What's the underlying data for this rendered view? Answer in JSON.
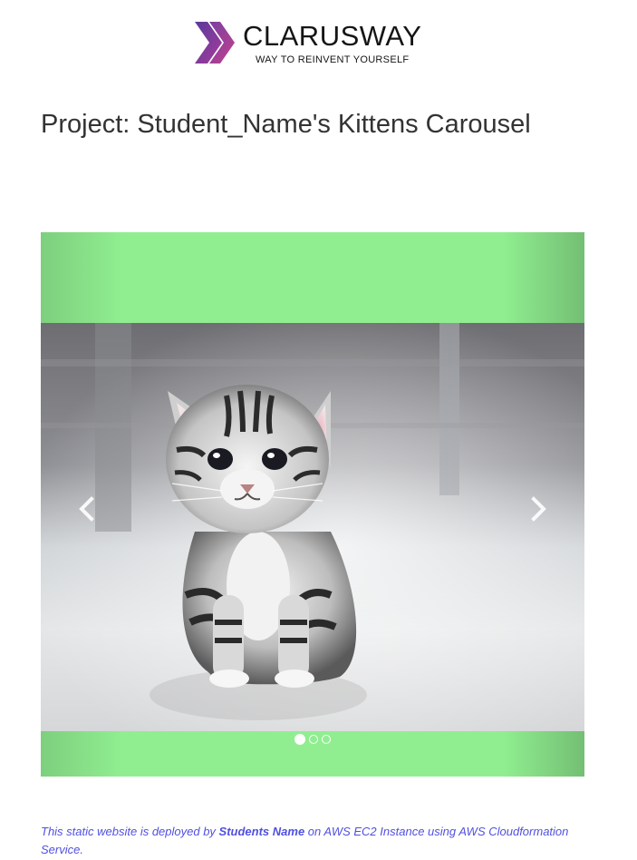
{
  "logo": {
    "name": "CLARUSWAY",
    "tagline": "WAY TO REINVENT YOURSELF"
  },
  "header": {
    "title": "Project: Student_Name's Kittens Carousel"
  },
  "carousel": {
    "prev_icon": "chevron-left-icon",
    "next_icon": "chevron-right-icon",
    "slide_count": 3,
    "active_slide": 1,
    "background_color": "#90ee90"
  },
  "footer": {
    "text_before": "This static website is deployed by ",
    "author": "Students Name",
    "text_after": " on AWS EC2 Instance using AWS Cloudformation Service.",
    "color": "#5050e0"
  }
}
